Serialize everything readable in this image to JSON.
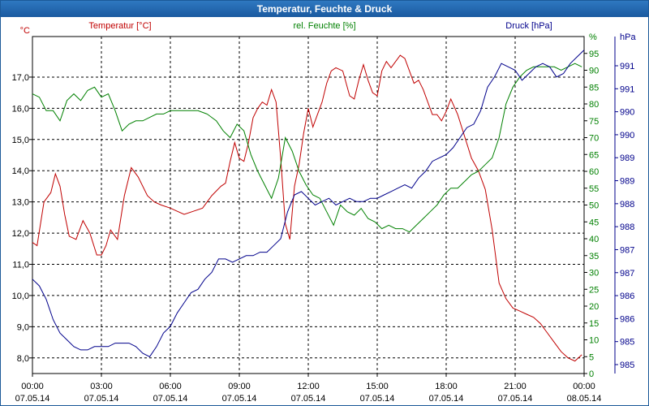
{
  "window": {
    "title": "Temperatur, Feuchte & Druck"
  },
  "chart_data": {
    "type": "line",
    "title": "Temperatur, Feuchte & Druck",
    "x_ticks": [
      {
        "time": "00:00",
        "date": "07.05.14"
      },
      {
        "time": "03:00",
        "date": "07.05.14"
      },
      {
        "time": "06:00",
        "date": "07.05.14"
      },
      {
        "time": "09:00",
        "date": "07.05.14"
      },
      {
        "time": "12:00",
        "date": "07.05.14"
      },
      {
        "time": "15:00",
        "date": "07.05.14"
      },
      {
        "time": "18:00",
        "date": "07.05.14"
      },
      {
        "time": "21:00",
        "date": "07.05.14"
      },
      {
        "time": "00:00",
        "date": "08.05.14"
      }
    ],
    "x_range_hours": [
      0,
      24
    ],
    "grid": true,
    "axes": {
      "temperature": {
        "label": "Temperatur [°C]",
        "unit": "°C",
        "color": "#c00000",
        "range": [
          7.5,
          18.3
        ],
        "ticks": [
          "8,0",
          "9,0",
          "10,0",
          "11,0",
          "12,0",
          "13,0",
          "14,0",
          "15,0",
          "16,0",
          "17,0"
        ],
        "tick_values": [
          8,
          9,
          10,
          11,
          12,
          13,
          14,
          15,
          16,
          17
        ]
      },
      "humidity": {
        "label": "rel. Feuchte [%]",
        "unit": "%",
        "color": "#008000",
        "range": [
          0,
          100
        ],
        "ticks": [
          "0",
          "5",
          "10",
          "15",
          "20",
          "25",
          "30",
          "35",
          "40",
          "45",
          "50",
          "55",
          "60",
          "65",
          "70",
          "75",
          "80",
          "85",
          "90",
          "95"
        ],
        "tick_values": [
          0,
          5,
          10,
          15,
          20,
          25,
          30,
          35,
          40,
          45,
          50,
          55,
          60,
          65,
          70,
          75,
          80,
          85,
          90,
          95
        ]
      },
      "pressure": {
        "label": "Druck [hPa]",
        "unit": "hPa",
        "color": "#00008b",
        "tick_labels": [
          "985",
          "985",
          "986",
          "986",
          "987",
          "987",
          "988",
          "988",
          "989",
          "989",
          "990",
          "990",
          "991",
          "991"
        ]
      }
    },
    "series": [
      {
        "name": "Temperatur [°C]",
        "axis": "temperature",
        "color": "#c00000",
        "x": [
          0,
          0.2,
          0.5,
          0.8,
          1.0,
          1.2,
          1.4,
          1.6,
          1.9,
          2.2,
          2.5,
          2.8,
          3.0,
          3.2,
          3.4,
          3.7,
          4.0,
          4.3,
          4.6,
          5.0,
          5.3,
          5.6,
          6.0,
          6.3,
          6.6,
          7.0,
          7.4,
          7.8,
          8.2,
          8.4,
          8.6,
          8.8,
          9.0,
          9.2,
          9.4,
          9.6,
          9.8,
          10.0,
          10.2,
          10.4,
          10.6,
          10.8,
          11.0,
          11.2,
          11.4,
          11.6,
          11.8,
          12.0,
          12.2,
          12.4,
          12.6,
          12.8,
          13.0,
          13.2,
          13.5,
          13.8,
          14.0,
          14.2,
          14.4,
          14.6,
          14.8,
          15.0,
          15.2,
          15.4,
          15.6,
          15.8,
          16.0,
          16.2,
          16.4,
          16.6,
          16.8,
          17.0,
          17.2,
          17.4,
          17.6,
          17.8,
          18.0,
          18.2,
          18.5,
          18.8,
          19.1,
          19.4,
          19.7,
          20.0,
          20.3,
          20.6,
          20.9,
          21.2,
          21.5,
          21.8,
          22.1,
          22.4,
          22.7,
          23.0,
          23.3,
          23.6,
          23.9
        ],
        "values": [
          11.7,
          11.6,
          13.0,
          13.3,
          13.9,
          13.5,
          12.6,
          11.9,
          11.8,
          12.4,
          12.0,
          11.3,
          11.3,
          11.6,
          12.1,
          11.8,
          13.2,
          14.1,
          13.8,
          13.2,
          13.0,
          12.9,
          12.8,
          12.7,
          12.6,
          12.7,
          12.8,
          13.2,
          13.5,
          13.6,
          14.3,
          14.9,
          14.4,
          14.3,
          14.9,
          15.7,
          16.0,
          16.2,
          16.1,
          16.6,
          16.2,
          14.4,
          12.3,
          11.8,
          13.5,
          14.2,
          15.2,
          16.0,
          15.4,
          15.8,
          16.2,
          16.8,
          17.2,
          17.3,
          17.2,
          16.4,
          16.3,
          16.9,
          17.4,
          16.9,
          16.5,
          16.4,
          17.2,
          17.5,
          17.3,
          17.5,
          17.7,
          17.6,
          17.2,
          16.8,
          16.9,
          16.6,
          16.2,
          15.8,
          15.8,
          15.6,
          15.9,
          16.3,
          15.8,
          15.1,
          14.4,
          14.0,
          13.4,
          12.1,
          10.4,
          9.9,
          9.6,
          9.5,
          9.4,
          9.3,
          9.1,
          8.8,
          8.5,
          8.2,
          8.0,
          7.9,
          8.1
        ]
      },
      {
        "name": "rel. Feuchte [%]",
        "axis": "humidity",
        "color": "#008000",
        "x": [
          0,
          0.3,
          0.6,
          0.9,
          1.2,
          1.5,
          1.8,
          2.1,
          2.4,
          2.7,
          3.0,
          3.3,
          3.6,
          3.9,
          4.2,
          4.5,
          4.8,
          5.1,
          5.4,
          5.7,
          6.0,
          6.4,
          6.8,
          7.2,
          7.6,
          8.0,
          8.3,
          8.6,
          8.9,
          9.2,
          9.5,
          9.8,
          10.1,
          10.4,
          10.7,
          11.0,
          11.3,
          11.6,
          11.9,
          12.2,
          12.5,
          12.8,
          13.1,
          13.4,
          13.7,
          14.0,
          14.3,
          14.6,
          14.9,
          15.2,
          15.5,
          15.8,
          16.1,
          16.4,
          16.7,
          17.0,
          17.3,
          17.6,
          17.9,
          18.2,
          18.5,
          18.8,
          19.1,
          19.4,
          19.7,
          20.0,
          20.3,
          20.6,
          20.9,
          21.2,
          21.5,
          21.8,
          22.1,
          22.4,
          22.7,
          23.0,
          23.3,
          23.6,
          23.9
        ],
        "values": [
          83,
          82,
          78,
          78,
          75,
          81,
          83,
          81,
          84,
          85,
          82,
          83,
          78,
          72,
          74,
          75,
          75,
          76,
          77,
          77,
          78,
          78,
          78,
          78,
          77,
          75,
          72,
          70,
          74,
          72,
          65,
          60,
          56,
          52,
          58,
          70,
          66,
          60,
          56,
          53,
          52,
          48,
          44,
          50,
          48,
          47,
          49,
          46,
          45,
          43,
          44,
          43,
          43,
          42,
          44,
          46,
          48,
          50,
          53,
          55,
          55,
          57,
          59,
          60,
          62,
          64,
          70,
          80,
          85,
          88,
          90,
          91,
          91,
          91,
          91,
          90,
          91,
          92,
          91
        ]
      },
      {
        "name": "Druck [hPa]",
        "axis": "pressure",
        "color": "#00008b",
        "x": [
          0,
          0.3,
          0.6,
          0.9,
          1.2,
          1.5,
          1.8,
          2.1,
          2.4,
          2.7,
          3.0,
          3.3,
          3.6,
          3.9,
          4.2,
          4.5,
          4.8,
          5.1,
          5.4,
          5.7,
          6.0,
          6.3,
          6.6,
          6.9,
          7.2,
          7.5,
          7.8,
          8.1,
          8.4,
          8.7,
          9.0,
          9.3,
          9.6,
          9.9,
          10.2,
          10.5,
          10.8,
          11.1,
          11.4,
          11.7,
          12.0,
          12.3,
          12.6,
          12.9,
          13.2,
          13.5,
          13.8,
          14.1,
          14.4,
          14.7,
          15.0,
          15.3,
          15.6,
          15.9,
          16.2,
          16.5,
          16.8,
          17.1,
          17.4,
          17.7,
          18.0,
          18.3,
          18.6,
          18.9,
          19.2,
          19.5,
          19.8,
          20.1,
          20.4,
          20.7,
          21.0,
          21.3,
          21.6,
          21.9,
          22.2,
          22.5,
          22.8,
          23.1,
          23.4,
          23.7,
          24.0
        ],
        "y_pos": [
          28,
          26,
          22,
          16,
          12,
          10,
          8,
          7,
          7,
          8,
          8,
          8,
          9,
          9,
          9,
          8,
          6,
          5,
          8,
          12,
          14,
          18,
          21,
          24,
          25,
          28,
          30,
          34,
          34,
          33,
          34,
          35,
          35,
          36,
          36,
          38,
          40,
          48,
          53,
          54,
          52,
          50,
          51,
          52,
          50,
          51,
          52,
          51,
          51,
          52,
          52,
          53,
          54,
          55,
          56,
          55,
          58,
          60,
          63,
          64,
          65,
          67,
          70,
          73,
          74,
          78,
          85,
          88,
          92,
          91,
          90,
          87,
          89,
          91,
          92,
          91,
          88,
          89,
          92,
          94,
          96
        ]
      }
    ]
  }
}
